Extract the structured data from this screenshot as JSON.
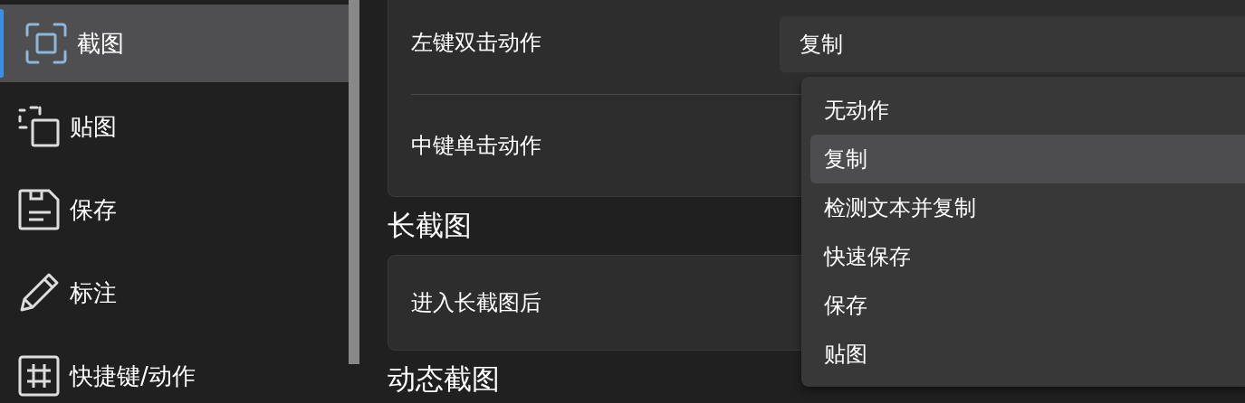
{
  "sidebar": {
    "items": [
      {
        "label": "截图",
        "kind": "capture",
        "selected": true
      },
      {
        "label": "贴图",
        "kind": "pin",
        "selected": false
      },
      {
        "label": "保存",
        "kind": "save",
        "selected": false
      },
      {
        "label": "标注",
        "kind": "pencil",
        "selected": false
      },
      {
        "label": "快捷键/动作",
        "kind": "hash",
        "selected": false
      }
    ]
  },
  "sections": [
    {
      "rows": [
        {
          "label": "左键双击动作",
          "value": "复制",
          "expanded": true
        },
        {
          "label": "中键单击动作"
        }
      ]
    },
    {
      "title": "长截图",
      "rows": [
        {
          "label": "进入长截图后"
        }
      ]
    },
    {
      "title": "动态截图"
    }
  ],
  "dropdown": {
    "options": [
      {
        "label": "无动作",
        "selected": false
      },
      {
        "label": "复制",
        "selected": true
      },
      {
        "label": "检测文本并复制",
        "selected": false
      },
      {
        "label": "快速保存",
        "selected": false
      },
      {
        "label": "保存",
        "selected": false
      },
      {
        "label": "贴图",
        "selected": false
      }
    ]
  }
}
